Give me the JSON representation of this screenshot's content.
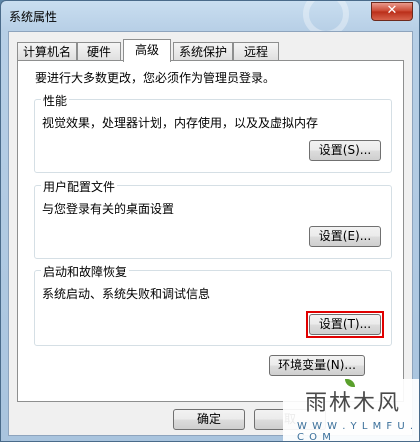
{
  "window": {
    "title": "系统属性",
    "close_glyph": "✕"
  },
  "tabs": [
    {
      "label": "计算机名",
      "active": false
    },
    {
      "label": "硬件",
      "active": false
    },
    {
      "label": "高级",
      "active": true
    },
    {
      "label": "系统保护",
      "active": false
    },
    {
      "label": "远程",
      "active": false
    }
  ],
  "admin_note": "要进行大多数更改，您必须作为管理员登录。",
  "performance": {
    "title": "性能",
    "description": "视觉效果，处理器计划，内存使用，以及及虚拟内存",
    "button": "设置(S)..."
  },
  "user_profiles": {
    "title": "用户配置文件",
    "description": "与您登录有关的桌面设置",
    "button": "设置(E)..."
  },
  "startup_recovery": {
    "title": "启动和故障恢复",
    "description": "系统启动、系统失败和调试信息",
    "button": "设置(T)..."
  },
  "env_button": "环境变量(N)...",
  "footer": {
    "ok": "确定",
    "cancel": "取"
  },
  "watermark": {
    "main": "雨林木风",
    "sub": "W W W . Y L M F U . C O M"
  },
  "colors": {
    "highlight": "#e00000",
    "titlebar": "#b7cfe6",
    "close": "#c9432e"
  }
}
